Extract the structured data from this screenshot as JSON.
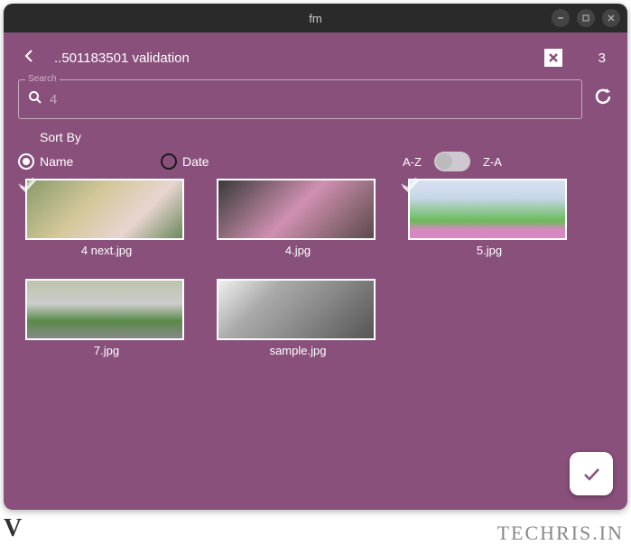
{
  "titlebar": {
    "title": "fm"
  },
  "header": {
    "path": "..501183501 validation",
    "count": "3"
  },
  "search": {
    "label": "Search",
    "value": "4"
  },
  "sort": {
    "label": "Sort By",
    "options": {
      "name": "Name",
      "date": "Date"
    },
    "selected": "name",
    "az": "A-Z",
    "za": "Z-A"
  },
  "items": [
    {
      "name": "4 next.jpg",
      "selected": true
    },
    {
      "name": "4.jpg",
      "selected": false
    },
    {
      "name": "5.jpg",
      "selected": true
    },
    {
      "name": "7.jpg",
      "selected": false
    },
    {
      "name": "sample.jpg",
      "selected": false
    }
  ],
  "watermark": {
    "left": "V",
    "right": "TECHRIS.IN"
  }
}
